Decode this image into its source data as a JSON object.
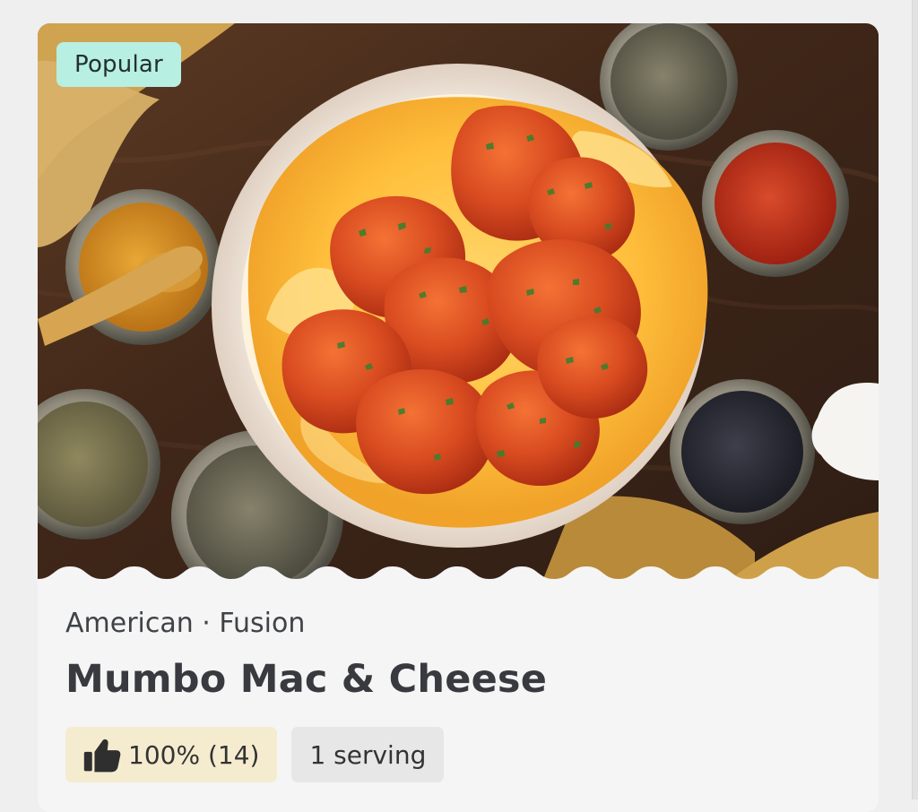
{
  "badge": {
    "label": "Popular"
  },
  "recipe": {
    "cuisine": "American · Fusion",
    "title": "Mumbo Mac & Cheese"
  },
  "chips": {
    "rating_label": "100% (14)",
    "serving_label": "1 serving"
  },
  "colors": {
    "background": "#efefef",
    "card": "#f5f5f5",
    "badge": "#b7efe3",
    "rating_chip": "#f5ecd0",
    "serving_chip": "#e7e7e7",
    "text_dark": "#383a3f"
  },
  "icons": {
    "thumb": "thumbs-up-icon"
  }
}
